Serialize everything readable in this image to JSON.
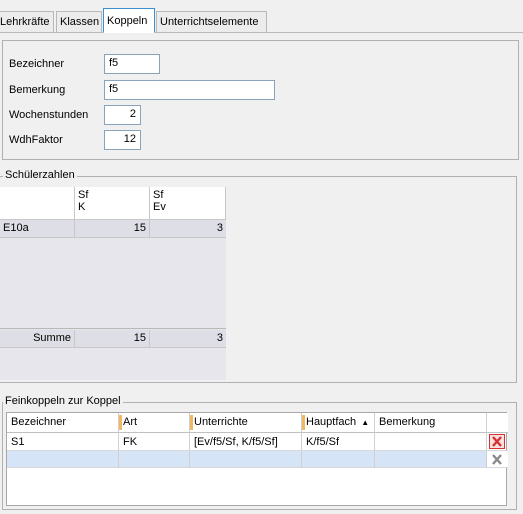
{
  "tabs": [
    {
      "label": "Lehrkräfte"
    },
    {
      "label": "Klassen"
    },
    {
      "label": "Koppeln"
    },
    {
      "label": "Unterrichtselemente"
    }
  ],
  "form": {
    "bezeichner_label": "Bezeichner",
    "bezeichner_value": "f5",
    "bemerkung_label": "Bemerkung",
    "bemerkung_value": "f5",
    "wochenstunden_label": "Wochenstunden",
    "wochenstunden_value": "2",
    "wdhfaktor_label": "WdhFaktor",
    "wdhfaktor_value": "12"
  },
  "schueler": {
    "title": "Schülerzahlen",
    "columns": [
      {
        "line1": "Sf",
        "line2": "K"
      },
      {
        "line1": "Sf",
        "line2": "Ev"
      }
    ],
    "rows": [
      {
        "label": "E10a",
        "values": [
          "15",
          "3"
        ]
      }
    ],
    "sum": {
      "label": "Summe",
      "values": [
        "15",
        "3"
      ]
    }
  },
  "feinkoppeln": {
    "title": "Feinkoppeln zur Koppel",
    "headers": [
      "Bezeichner",
      "Art",
      "Unterrichte",
      "Hauptfach",
      "Bemerkung"
    ],
    "rows": [
      [
        "S1",
        "FK",
        "[Ev/f5/Sf, K/f5/Sf]",
        "K/f5/Sf",
        ""
      ],
      [
        "",
        "",
        "",
        "",
        ""
      ]
    ]
  },
  "colors": {
    "accent": "#3c8fd0",
    "delete_red": "#d83030",
    "selected_row": "#d6e4f7"
  }
}
